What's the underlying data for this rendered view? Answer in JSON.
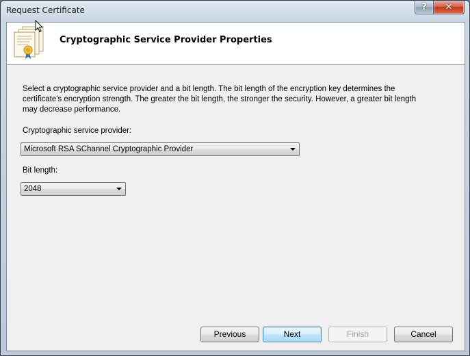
{
  "window": {
    "title": "Request Certificate",
    "help_glyph": "?",
    "close_glyph": "✕"
  },
  "header": {
    "title": "Cryptographic Service Provider Properties",
    "icon": "certificate-icon"
  },
  "content": {
    "description": "Select a cryptographic service provider and a bit length. The bit length of the encryption key determines the certificate's encryption strength. The greater the bit length, the stronger the security. However, a greater bit length may decrease performance.",
    "provider_label": "Cryptographic service provider:",
    "provider_value": "Microsoft RSA SChannel Cryptographic Provider",
    "bitlength_label": "Bit length:",
    "bitlength_value": "2048"
  },
  "buttons": {
    "previous": "Previous",
    "next": "Next",
    "finish": "Finish",
    "cancel": "Cancel"
  },
  "colors": {
    "default_button_border": "#3c7fb1",
    "close_button": "#c3361a"
  }
}
